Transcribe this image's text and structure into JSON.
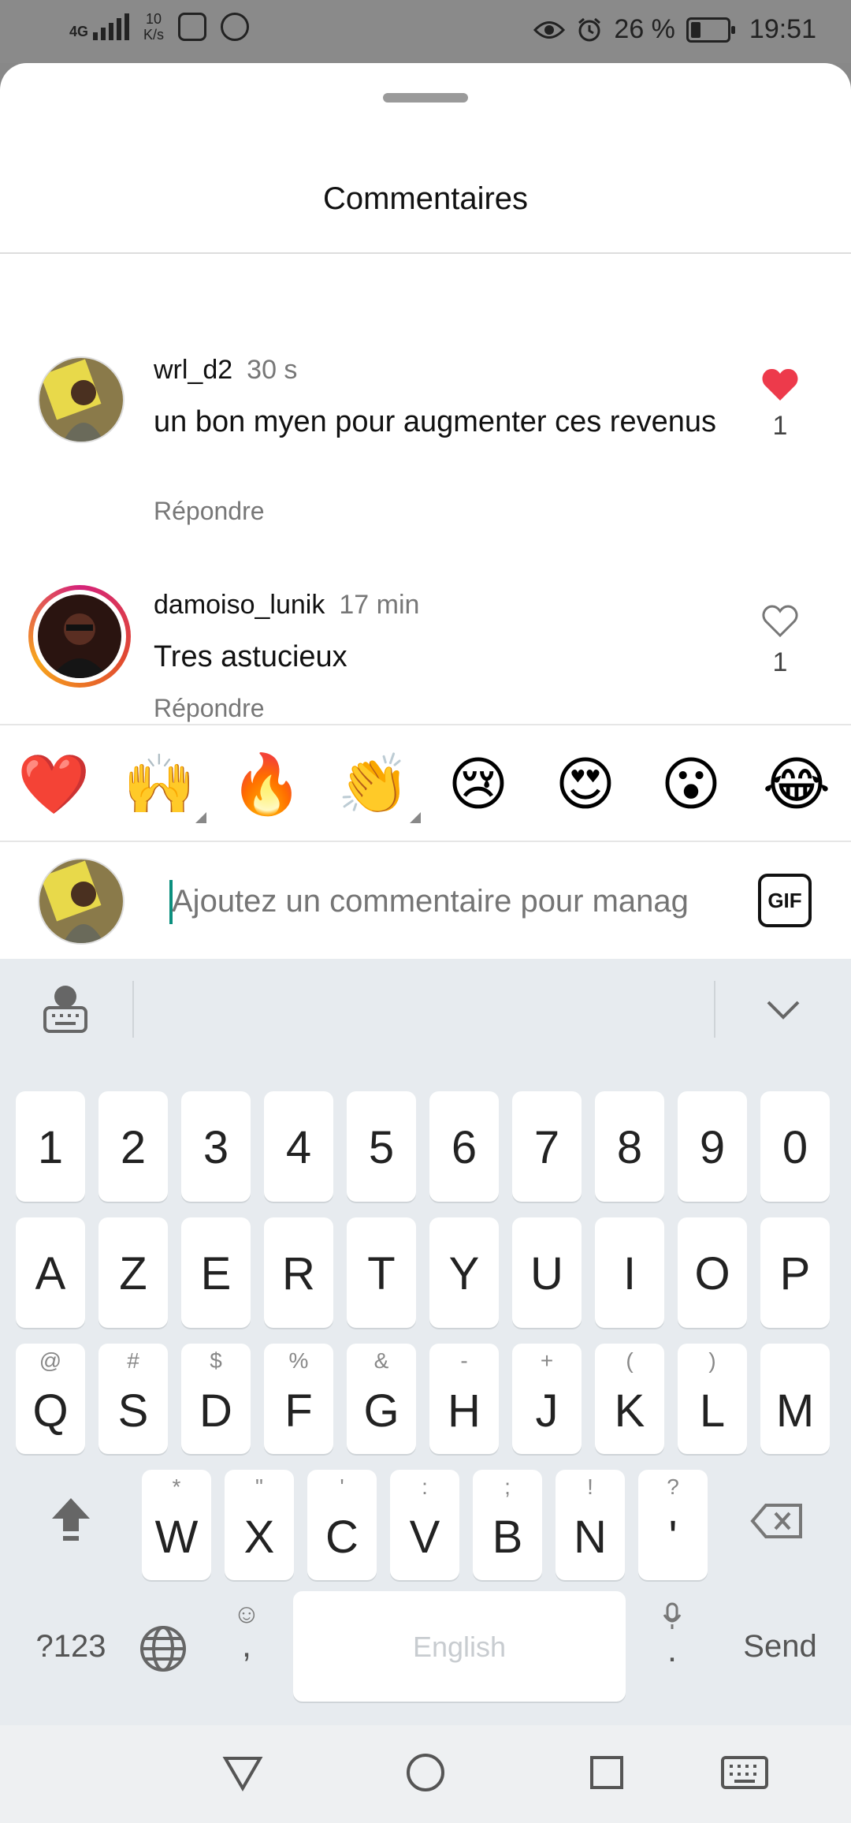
{
  "status_bar": {
    "network": "4G",
    "speed_value": "10",
    "speed_unit": "K/s",
    "battery": "26 %",
    "time": "19:51"
  },
  "sheet": {
    "title": "Commentaires",
    "comments": [
      {
        "user": "wrl_d2",
        "time": "30 s",
        "text": "un bon myen pour augmenter ces revenus",
        "reply": "Répondre",
        "likes": "1",
        "liked": true
      },
      {
        "user": "damoiso_lunik",
        "time": "17 min",
        "text": "Tres astucieux",
        "reply": "Répondre",
        "likes": "1",
        "liked": false
      }
    ],
    "emojis": [
      "❤️",
      "🙌",
      "🔥",
      "👏",
      "😢",
      "😍",
      "😮",
      "😂"
    ],
    "input": {
      "placeholder": "Ajoutez un commentaire pour manag",
      "gif_label": "GIF"
    }
  },
  "keyboard": {
    "number_row": [
      "1",
      "2",
      "3",
      "4",
      "5",
      "6",
      "7",
      "8",
      "9",
      "0"
    ],
    "row1": [
      "A",
      "Z",
      "E",
      "R",
      "T",
      "Y",
      "U",
      "I",
      "O",
      "P"
    ],
    "row2": [
      {
        "key": "Q",
        "sub": "@"
      },
      {
        "key": "S",
        "sub": "#"
      },
      {
        "key": "D",
        "sub": "$"
      },
      {
        "key": "F",
        "sub": "%"
      },
      {
        "key": "G",
        "sub": "&"
      },
      {
        "key": "H",
        "sub": "-"
      },
      {
        "key": "J",
        "sub": "+"
      },
      {
        "key": "K",
        "sub": "("
      },
      {
        "key": "L",
        "sub": ")"
      },
      {
        "key": "M",
        "sub": ""
      }
    ],
    "row3": [
      {
        "key": "W",
        "sub": "*"
      },
      {
        "key": "X",
        "sub": "\""
      },
      {
        "key": "C",
        "sub": "'"
      },
      {
        "key": "V",
        "sub": ":"
      },
      {
        "key": "B",
        "sub": ";"
      },
      {
        "key": "N",
        "sub": "!"
      },
      {
        "key": "'",
        "sub": "?"
      }
    ],
    "symbols_label": "?123",
    "comma": ",",
    "space_label": "English",
    "period": ".",
    "send_label": "Send"
  },
  "colors": {
    "like_red": "#ed3a4b",
    "caret_teal": "#0b8f7e",
    "keyboard_bg": "#e7ebef"
  }
}
